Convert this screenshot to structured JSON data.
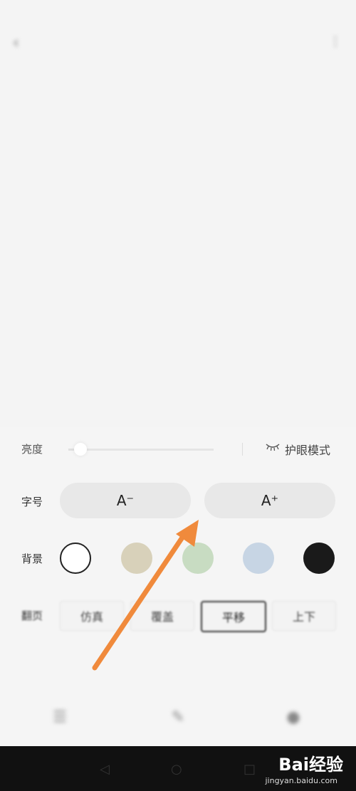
{
  "status_bar": {
    "left": "",
    "right": ""
  },
  "topbar": {
    "right_label": ""
  },
  "reader": {
    "chapter_title": "",
    "paragraphs": [
      "",
      ""
    ]
  },
  "panel": {
    "brightness": {
      "label": "亮度",
      "eye_mode_label": "护眼模式",
      "level": 0.05
    },
    "font_size": {
      "label": "字号",
      "decrease": "A⁻",
      "increase": "A⁺"
    },
    "background": {
      "label": "背景",
      "swatches": [
        "#ffffff",
        "#d8d1ba",
        "#c8dcc2",
        "#c7d5e4",
        "#1a1a1a"
      ],
      "selected_index": 0
    },
    "page_turn": {
      "label": "翻页",
      "options": [
        "仿真",
        "覆盖",
        "平移",
        "上下"
      ],
      "selected_index": 2
    },
    "extra": {
      "left": "",
      "right": ""
    }
  },
  "watermark": {
    "brand": "Bai经验",
    "url": "jingyan.baidu.com"
  },
  "colors": {
    "arrow": "#f08a3c"
  }
}
